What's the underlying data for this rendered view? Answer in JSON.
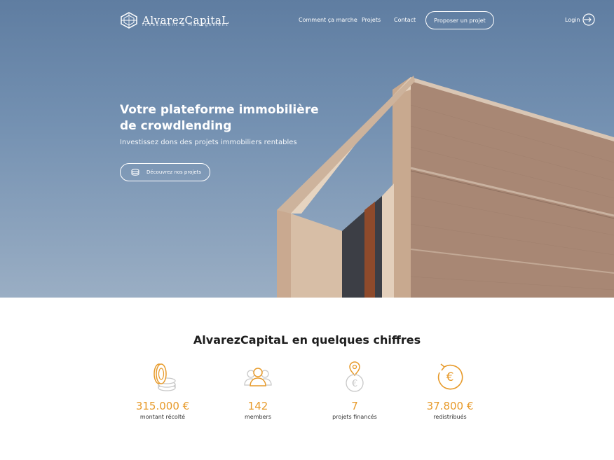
{
  "header": {
    "brand_name": "AlvarezCapitaL",
    "brand_tagline": "Investment & Management",
    "nav": [
      "Comment ça marche",
      "Projets",
      "Contact"
    ],
    "cta_label": "Proposer un projet",
    "login_label": "Login"
  },
  "hero": {
    "title": "Votre plateforme immobilière de crowdlending",
    "subtitle": "Investissez dons des projets immobiliers rentables",
    "button_label": "Découvrez nos projets"
  },
  "stats": {
    "title": "AlvarezCapitaL en quelques chiffres",
    "items": [
      {
        "value": "315.000 €",
        "label": "montant récolté",
        "icon": "coins-icon"
      },
      {
        "value": "142",
        "label": "members",
        "icon": "users-icon"
      },
      {
        "value": "7",
        "label": "projets financés",
        "icon": "location-euro-icon"
      },
      {
        "value": "37.800 €",
        "label": "redistribués",
        "icon": "euro-refresh-icon"
      }
    ]
  },
  "colors": {
    "accent": "#e79a2a",
    "sky": "#6f8cae",
    "brick": "#b0917d"
  }
}
